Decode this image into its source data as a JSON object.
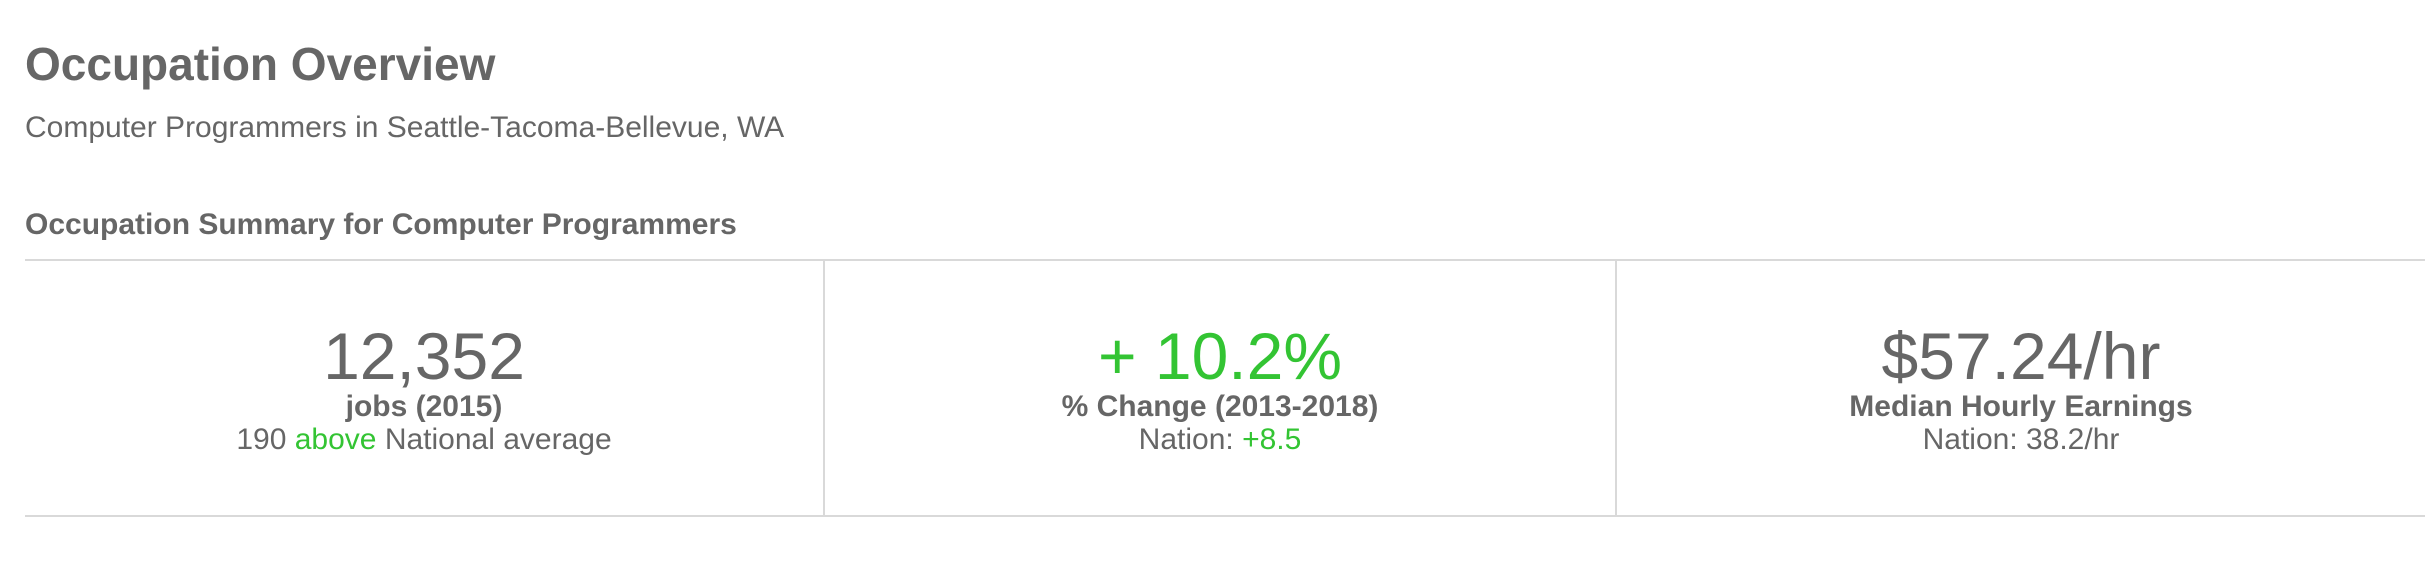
{
  "header": {
    "title": "Occupation Overview",
    "subtitle": "Computer Programmers in Seattle-Tacoma-Bellevue, WA"
  },
  "summary": {
    "title": "Occupation Summary for Computer Programmers",
    "jobs": {
      "value": "12,352",
      "label": "jobs (2015)",
      "note_prefix": "190",
      "note_highlight": "above",
      "note_suffix": "National average"
    },
    "change": {
      "value": "+ 10.2%",
      "label": "% Change (2013-2018)",
      "note_prefix": "Nation:",
      "note_highlight": "+8.5"
    },
    "earnings": {
      "value": "$57.24/hr",
      "label": "Median Hourly Earnings",
      "note": "Nation: 38.2/hr"
    }
  },
  "colors": {
    "text": "#666666",
    "positive": "#33c433",
    "divider": "#d9d9d9"
  }
}
